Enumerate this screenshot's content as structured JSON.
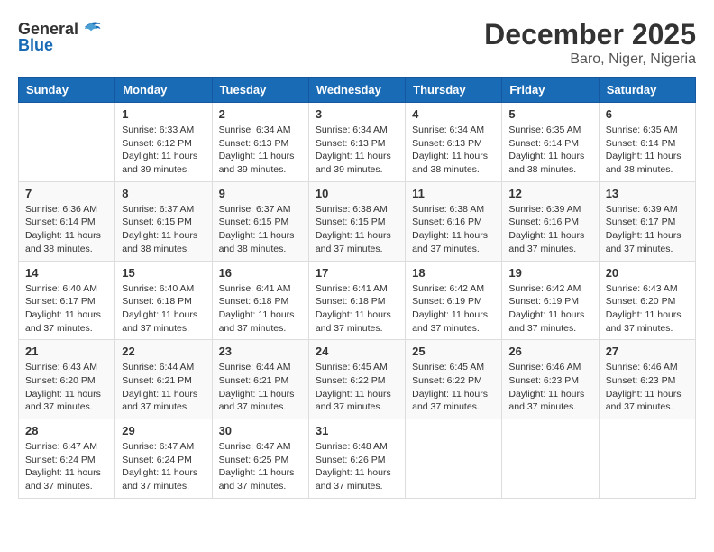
{
  "header": {
    "logo_general": "General",
    "logo_blue": "Blue",
    "month_year": "December 2025",
    "location": "Baro, Niger, Nigeria"
  },
  "days_of_week": [
    "Sunday",
    "Monday",
    "Tuesday",
    "Wednesday",
    "Thursday",
    "Friday",
    "Saturday"
  ],
  "weeks": [
    [
      {
        "day": "",
        "info": ""
      },
      {
        "day": "1",
        "info": "Sunrise: 6:33 AM\nSunset: 6:12 PM\nDaylight: 11 hours\nand 39 minutes."
      },
      {
        "day": "2",
        "info": "Sunrise: 6:34 AM\nSunset: 6:13 PM\nDaylight: 11 hours\nand 39 minutes."
      },
      {
        "day": "3",
        "info": "Sunrise: 6:34 AM\nSunset: 6:13 PM\nDaylight: 11 hours\nand 39 minutes."
      },
      {
        "day": "4",
        "info": "Sunrise: 6:34 AM\nSunset: 6:13 PM\nDaylight: 11 hours\nand 38 minutes."
      },
      {
        "day": "5",
        "info": "Sunrise: 6:35 AM\nSunset: 6:14 PM\nDaylight: 11 hours\nand 38 minutes."
      },
      {
        "day": "6",
        "info": "Sunrise: 6:35 AM\nSunset: 6:14 PM\nDaylight: 11 hours\nand 38 minutes."
      }
    ],
    [
      {
        "day": "7",
        "info": "Sunrise: 6:36 AM\nSunset: 6:14 PM\nDaylight: 11 hours\nand 38 minutes."
      },
      {
        "day": "8",
        "info": "Sunrise: 6:37 AM\nSunset: 6:15 PM\nDaylight: 11 hours\nand 38 minutes."
      },
      {
        "day": "9",
        "info": "Sunrise: 6:37 AM\nSunset: 6:15 PM\nDaylight: 11 hours\nand 38 minutes."
      },
      {
        "day": "10",
        "info": "Sunrise: 6:38 AM\nSunset: 6:15 PM\nDaylight: 11 hours\nand 37 minutes."
      },
      {
        "day": "11",
        "info": "Sunrise: 6:38 AM\nSunset: 6:16 PM\nDaylight: 11 hours\nand 37 minutes."
      },
      {
        "day": "12",
        "info": "Sunrise: 6:39 AM\nSunset: 6:16 PM\nDaylight: 11 hours\nand 37 minutes."
      },
      {
        "day": "13",
        "info": "Sunrise: 6:39 AM\nSunset: 6:17 PM\nDaylight: 11 hours\nand 37 minutes."
      }
    ],
    [
      {
        "day": "14",
        "info": "Sunrise: 6:40 AM\nSunset: 6:17 PM\nDaylight: 11 hours\nand 37 minutes."
      },
      {
        "day": "15",
        "info": "Sunrise: 6:40 AM\nSunset: 6:18 PM\nDaylight: 11 hours\nand 37 minutes."
      },
      {
        "day": "16",
        "info": "Sunrise: 6:41 AM\nSunset: 6:18 PM\nDaylight: 11 hours\nand 37 minutes."
      },
      {
        "day": "17",
        "info": "Sunrise: 6:41 AM\nSunset: 6:18 PM\nDaylight: 11 hours\nand 37 minutes."
      },
      {
        "day": "18",
        "info": "Sunrise: 6:42 AM\nSunset: 6:19 PM\nDaylight: 11 hours\nand 37 minutes."
      },
      {
        "day": "19",
        "info": "Sunrise: 6:42 AM\nSunset: 6:19 PM\nDaylight: 11 hours\nand 37 minutes."
      },
      {
        "day": "20",
        "info": "Sunrise: 6:43 AM\nSunset: 6:20 PM\nDaylight: 11 hours\nand 37 minutes."
      }
    ],
    [
      {
        "day": "21",
        "info": "Sunrise: 6:43 AM\nSunset: 6:20 PM\nDaylight: 11 hours\nand 37 minutes."
      },
      {
        "day": "22",
        "info": "Sunrise: 6:44 AM\nSunset: 6:21 PM\nDaylight: 11 hours\nand 37 minutes."
      },
      {
        "day": "23",
        "info": "Sunrise: 6:44 AM\nSunset: 6:21 PM\nDaylight: 11 hours\nand 37 minutes."
      },
      {
        "day": "24",
        "info": "Sunrise: 6:45 AM\nSunset: 6:22 PM\nDaylight: 11 hours\nand 37 minutes."
      },
      {
        "day": "25",
        "info": "Sunrise: 6:45 AM\nSunset: 6:22 PM\nDaylight: 11 hours\nand 37 minutes."
      },
      {
        "day": "26",
        "info": "Sunrise: 6:46 AM\nSunset: 6:23 PM\nDaylight: 11 hours\nand 37 minutes."
      },
      {
        "day": "27",
        "info": "Sunrise: 6:46 AM\nSunset: 6:23 PM\nDaylight: 11 hours\nand 37 minutes."
      }
    ],
    [
      {
        "day": "28",
        "info": "Sunrise: 6:47 AM\nSunset: 6:24 PM\nDaylight: 11 hours\nand 37 minutes."
      },
      {
        "day": "29",
        "info": "Sunrise: 6:47 AM\nSunset: 6:24 PM\nDaylight: 11 hours\nand 37 minutes."
      },
      {
        "day": "30",
        "info": "Sunrise: 6:47 AM\nSunset: 6:25 PM\nDaylight: 11 hours\nand 37 minutes."
      },
      {
        "day": "31",
        "info": "Sunrise: 6:48 AM\nSunset: 6:26 PM\nDaylight: 11 hours\nand 37 minutes."
      },
      {
        "day": "",
        "info": ""
      },
      {
        "day": "",
        "info": ""
      },
      {
        "day": "",
        "info": ""
      }
    ]
  ]
}
